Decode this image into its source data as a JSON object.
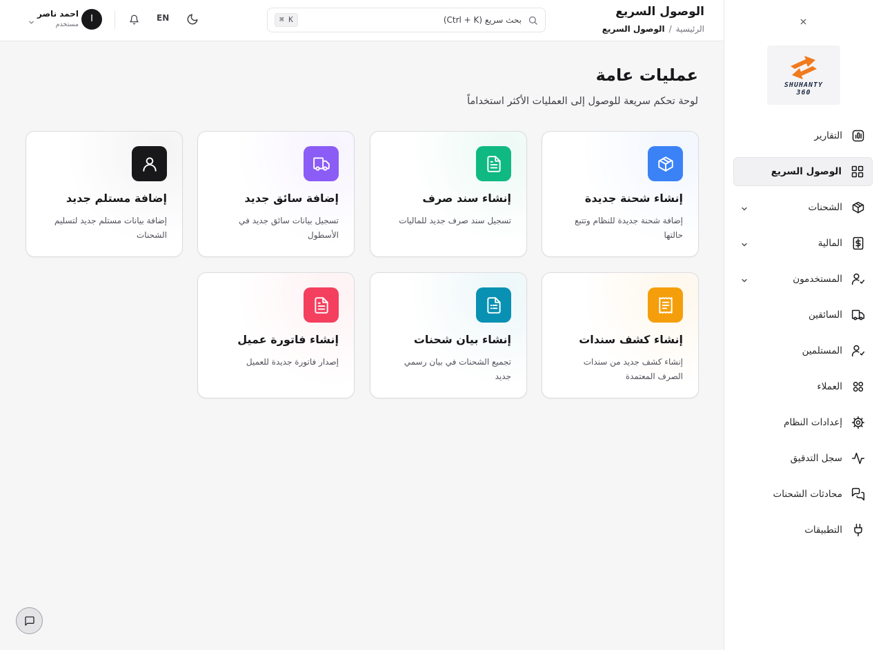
{
  "header": {
    "title": "الوصول السريع",
    "breadcrumb": {
      "home": "الرئيسية",
      "separator": "/",
      "current": "الوصول السريع"
    },
    "search": {
      "placeholder": "بحث سريع (Ctrl + K)",
      "shortcut": "⌘ K"
    },
    "language": "EN",
    "user": {
      "name": "احمد ناصر",
      "role": "مستخدم",
      "initial": "I"
    }
  },
  "sidebar": {
    "logo": {
      "line1": "SHUHANTY",
      "line2": "360"
    },
    "items": [
      {
        "label": "التقارير",
        "icon": "chart-icon",
        "active": false,
        "expandable": false
      },
      {
        "label": "الوصول السريع",
        "icon": "grid-icon",
        "active": true,
        "expandable": false
      },
      {
        "label": "الشحنات",
        "icon": "box-icon",
        "active": false,
        "expandable": true
      },
      {
        "label": "المالية",
        "icon": "dollar-icon",
        "active": false,
        "expandable": true
      },
      {
        "label": "المستخدمون",
        "icon": "user-check-icon",
        "active": false,
        "expandable": true
      },
      {
        "label": "السائقين",
        "icon": "truck-icon",
        "active": false,
        "expandable": false
      },
      {
        "label": "المستلمين",
        "icon": "user-check-icon",
        "active": false,
        "expandable": false
      },
      {
        "label": "العملاء",
        "icon": "clients-icon",
        "active": false,
        "expandable": false
      },
      {
        "label": "إعدادات النظام",
        "icon": "settings-icon",
        "active": false,
        "expandable": false
      },
      {
        "label": "سجل التدقيق",
        "icon": "activity-icon",
        "active": false,
        "expandable": false
      },
      {
        "label": "محادثات الشحنات",
        "icon": "chat-icon",
        "active": false,
        "expandable": false
      },
      {
        "label": "التطبيقات",
        "icon": "plug-icon",
        "active": false,
        "expandable": false
      }
    ]
  },
  "main": {
    "title": "عمليات عامة",
    "subtitle": "لوحة تحكم سريعة للوصول إلى العمليات الأكثر استخداماً",
    "cards": [
      {
        "title": "إنشاء شحنة جديدة",
        "desc": "إضافة شحنة جديدة للنظام وتتبع حالتها",
        "icon": "package-icon",
        "color": "#3b82f6"
      },
      {
        "title": "إنشاء سند صرف",
        "desc": "تسجيل سند صرف جديد للماليات",
        "icon": "document-icon",
        "color": "#10b981"
      },
      {
        "title": "إضافة سائق جديد",
        "desc": "تسجيل بيانات سائق جديد في الأسطول",
        "icon": "truck-icon",
        "color": "#8b5cf6"
      },
      {
        "title": "إضافة مستلم جديد",
        "desc": "إضافة بيانات مستلم جديد لتسليم الشحنات",
        "icon": "user-icon",
        "color": "#18181b"
      },
      {
        "title": "إنشاء كشف سندات",
        "desc": "إنشاء كشف جديد من سندات الصرف المعتمدة",
        "icon": "receipt-icon",
        "color": "#f59e0b"
      },
      {
        "title": "إنشاء بيان شحنات",
        "desc": "تجميع الشحنات في بيان رسمي جديد",
        "icon": "manifest-icon",
        "color": "#0891b2"
      },
      {
        "title": "إنشاء فاتورة عميل",
        "desc": "إصدار فاتورة جديدة للعميل",
        "icon": "invoice-icon",
        "color": "#f43f5e"
      }
    ]
  }
}
